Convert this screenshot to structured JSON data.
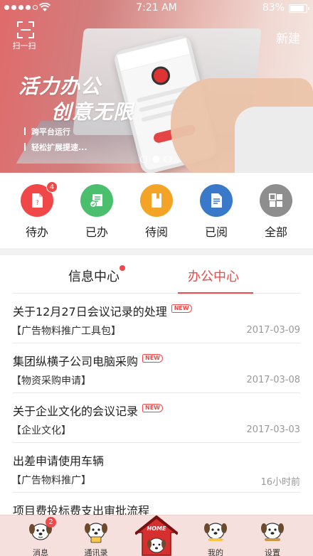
{
  "status_bar": {
    "time": "7:21 AM",
    "battery": "83%"
  },
  "header": {
    "scan_label": "扫一扫",
    "new_label": "新建"
  },
  "banner": {
    "slogan_1": "活力办公",
    "slogan_2": "创意无限",
    "bullets": [
      "跨平台运行",
      "轻松扩展提速..."
    ]
  },
  "quick_actions": [
    {
      "label": "待办",
      "badge": "4",
      "color": "#f04848",
      "icon": "todo-icon"
    },
    {
      "label": "已办",
      "badge": "",
      "color": "#4cbf6e",
      "icon": "done-icon"
    },
    {
      "label": "待阅",
      "badge": "",
      "color": "#f3a325",
      "icon": "to-read-icon"
    },
    {
      "label": "已阅",
      "badge": "",
      "color": "#3a78c9",
      "icon": "read-icon"
    },
    {
      "label": "全部",
      "badge": "",
      "color": "#8e8e8e",
      "icon": "grid-icon"
    }
  ],
  "tabs": {
    "info": "信息中心",
    "office": "办公中心"
  },
  "list": [
    {
      "title": "关于12月27日会议记录的处理",
      "is_new": true,
      "new_label": "NEW",
      "category": "【广告物料推广工具包】",
      "date": "2017-03-09"
    },
    {
      "title": "集团纵横子公司电脑采购",
      "is_new": true,
      "new_label": "NEW",
      "category": "【物资采购申请】",
      "date": "2017-03-08"
    },
    {
      "title": "关于企业文化的会议记录",
      "is_new": true,
      "new_label": "NEW",
      "category": "【企业文化】",
      "date": "2017-03-03"
    },
    {
      "title": "出差申请使用车辆",
      "is_new": false,
      "new_label": "",
      "category": "【广告物料推广】",
      "date": "16小时前"
    },
    {
      "title": "项目费投标费支出审批流程",
      "is_new": false,
      "new_label": "",
      "category": "",
      "date": ""
    }
  ],
  "tab_bar": {
    "messages": {
      "label": "消息",
      "badge": "2"
    },
    "contacts": {
      "label": "通讯录"
    },
    "home": {
      "label": "HOME"
    },
    "mine": {
      "label": "我的"
    },
    "settings": {
      "label": "设置"
    }
  },
  "colors": {
    "accent": "#f04848",
    "tabbar_bg": "#f6e0dd"
  }
}
